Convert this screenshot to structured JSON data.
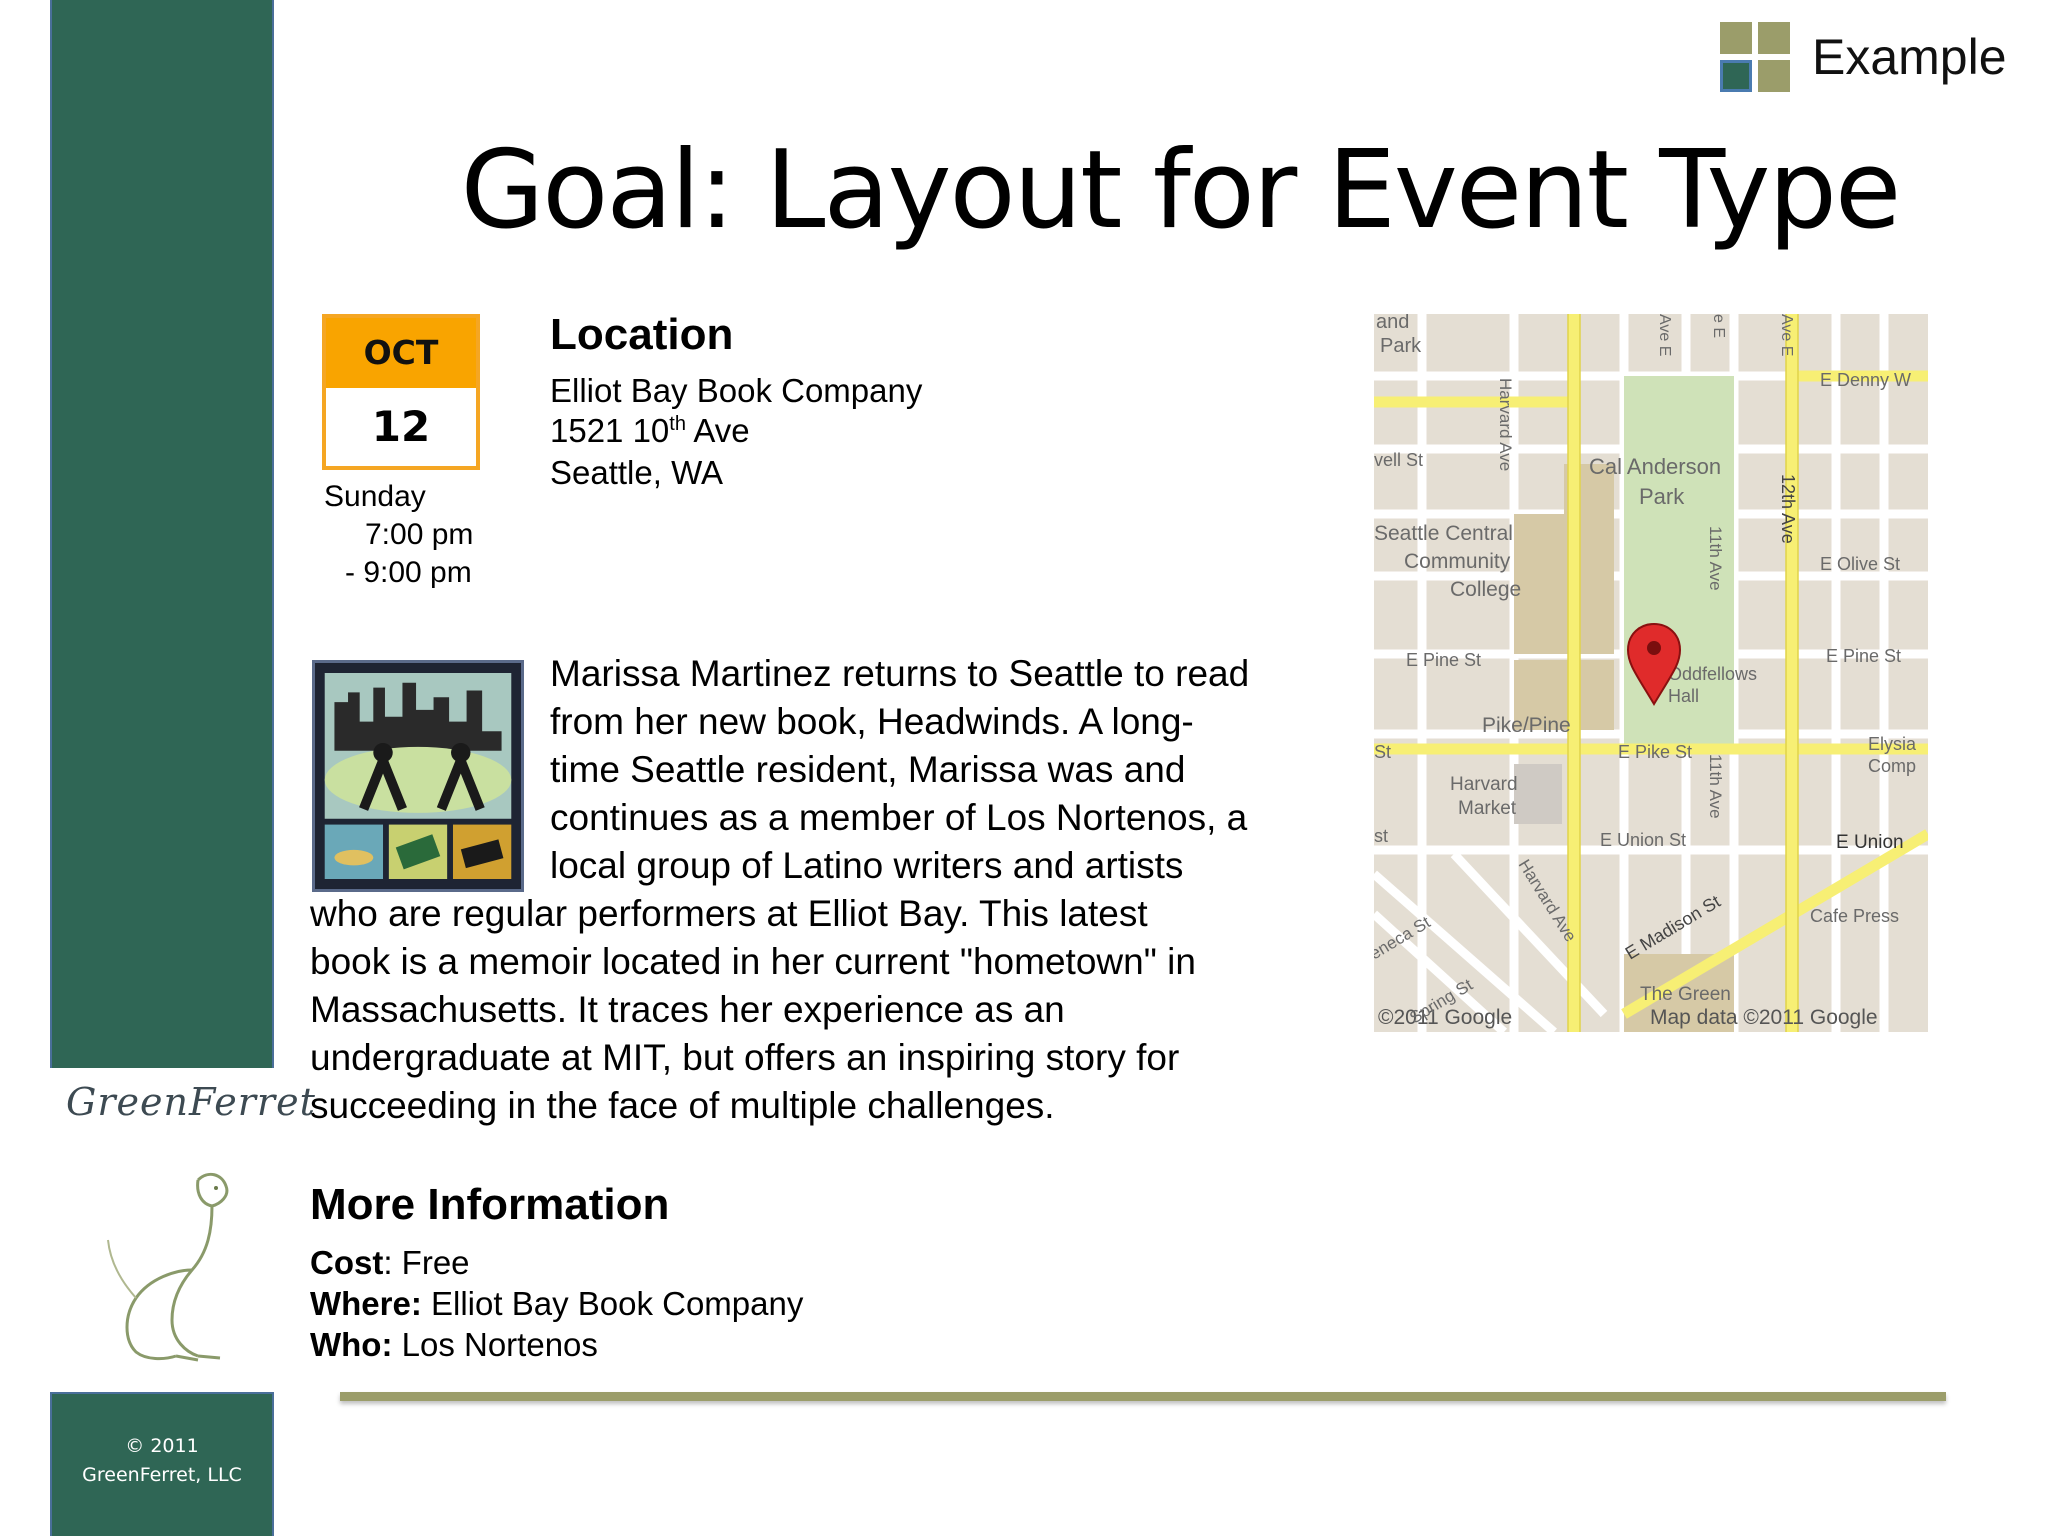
{
  "brand": {
    "label": "Example"
  },
  "title": "Goal: Layout for Event Type",
  "date": {
    "month": "OCT",
    "day": "12",
    "weekday": "Sunday",
    "time_start": "7:00 pm",
    "time_end": "- 9:00 pm"
  },
  "location": {
    "heading": "Location",
    "venue": "Elliot Bay Book Company",
    "street_pre": "1521 10",
    "street_sup": "th",
    "street_post": " Ave",
    "city": "Seattle, WA"
  },
  "description": {
    "lines": [
      "Marissa Martinez returns to Seattle to read",
      "from her new book, Headwinds. A long-",
      "time Seattle resident, Marissa was and",
      "continues as a member of Los Nortenos, a",
      "local group of Latino writers and artists",
      "who are regular performers at Elliot Bay. This latest",
      "book is a memoir located in her current \"hometown\" in",
      "Massachusetts. It traces her experience as an",
      "undergraduate at MIT, but offers an inspiring story for",
      "succeeding in the face of multiple challenges."
    ]
  },
  "more_info": {
    "heading": "More Information",
    "cost_label": "Cost",
    "cost_value": ": Free",
    "where_label": "Where:",
    "where_value": " Elliot Bay Book Company",
    "who_label": "Who:",
    "who_value": " Los Nortenos"
  },
  "map": {
    "labels": {
      "park1a": "and",
      "park1b": "Park",
      "denny": "E Denny W",
      "harvard1": "Harvard Ave",
      "cal1": "Cal Anderson",
      "cal2": "Park",
      "twelfth": "12th Ave",
      "vell": "vell St",
      "sccc1": "Seattle Central",
      "sccc2": "Community",
      "sccc3": "College",
      "eleventh1": "11th Ave",
      "olive": "E Olive St",
      "pine_w": "E Pine St",
      "pine_e": "E Pine St",
      "odd1": "Oddfellows",
      "odd2": "Hall",
      "pikepine": "Pike/Pine",
      "st_left": "St",
      "pike": "E Pike St",
      "elysian1": "Elysia",
      "elysian2": "Comp",
      "hm1": "Harvard",
      "hm2": "Market",
      "eleventh2": "11th Ave",
      "union": "E Union St",
      "union_e": "E Union",
      "st_left2": "st",
      "harvard2": "Harvard Ave",
      "madison": "E Madison St",
      "cafe": "Cafe Press",
      "seneca": "eneca St",
      "spring": "Spring St",
      "green": "The Green",
      "copy": "©2011 Google",
      "mapdata": "Map data ©2011 Google",
      "ave_e1": "Ave E",
      "ave_e2": "e E",
      "ave_top": "Ave E"
    }
  },
  "sidebar": {
    "logo_text": "GreenFerret",
    "copyright_line1": "© 2011",
    "copyright_line2": "GreenFerret, LLC"
  }
}
